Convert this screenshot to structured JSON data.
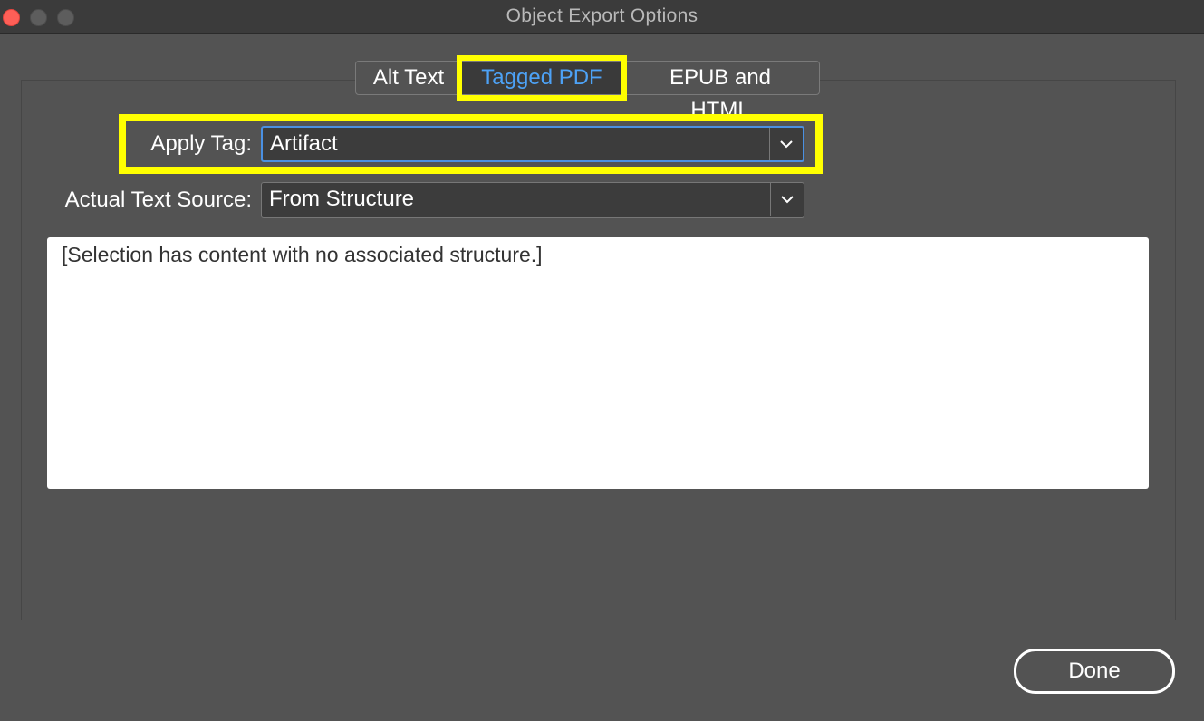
{
  "window": {
    "title": "Object Export Options"
  },
  "tabs": [
    {
      "label": "Alt Text",
      "active": false
    },
    {
      "label": "Tagged PDF",
      "active": true
    },
    {
      "label": "EPUB and HTML",
      "active": false
    }
  ],
  "apply_tag": {
    "label": "Apply Tag:",
    "value": "Artifact"
  },
  "actual_text_source": {
    "label": "Actual Text Source:",
    "value": "From Structure"
  },
  "text_area": {
    "value": "[Selection has content with no associated structure.]"
  },
  "footer": {
    "done_label": "Done"
  },
  "colors": {
    "background": "#535353",
    "active_tab_text": "#4da2f6",
    "highlight": "#ffff00",
    "close_button": "#fe5f57"
  }
}
